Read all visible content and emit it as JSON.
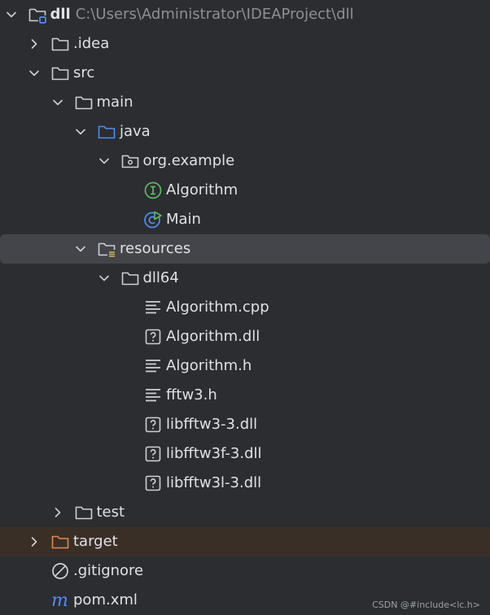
{
  "tree": [
    {
      "depth": 0,
      "label": "dll",
      "path": "C:\\Users\\Administrator\\IDEAProject\\dll",
      "icon": "module-folder-icon",
      "chevron": "down",
      "bold": true
    },
    {
      "depth": 1,
      "label": ".idea",
      "icon": "folder-icon",
      "chevron": "right"
    },
    {
      "depth": 1,
      "label": "src",
      "icon": "folder-icon",
      "chevron": "down"
    },
    {
      "depth": 2,
      "label": "main",
      "icon": "folder-icon",
      "chevron": "down"
    },
    {
      "depth": 3,
      "label": "java",
      "icon": "source-folder-icon",
      "chevron": "down"
    },
    {
      "depth": 4,
      "label": "org.example",
      "icon": "package-icon",
      "chevron": "down"
    },
    {
      "depth": 5,
      "label": "Algorithm",
      "icon": "interface-icon",
      "chevron": "none"
    },
    {
      "depth": 5,
      "label": "Main",
      "icon": "runnable-class-icon",
      "chevron": "none"
    },
    {
      "depth": 3,
      "label": "resources",
      "icon": "resources-folder-icon",
      "chevron": "down",
      "selected": true
    },
    {
      "depth": 4,
      "label": "dll64",
      "icon": "folder-icon",
      "chevron": "down"
    },
    {
      "depth": 5,
      "label": "Algorithm.cpp",
      "icon": "text-file-icon",
      "chevron": "none"
    },
    {
      "depth": 5,
      "label": "Algorithm.dll",
      "icon": "unknown-file-icon",
      "chevron": "none"
    },
    {
      "depth": 5,
      "label": "Algorithm.h",
      "icon": "text-file-icon",
      "chevron": "none"
    },
    {
      "depth": 5,
      "label": "fftw3.h",
      "icon": "text-file-icon",
      "chevron": "none"
    },
    {
      "depth": 5,
      "label": "libfftw3-3.dll",
      "icon": "unknown-file-icon",
      "chevron": "none"
    },
    {
      "depth": 5,
      "label": "libfftw3f-3.dll",
      "icon": "unknown-file-icon",
      "chevron": "none"
    },
    {
      "depth": 5,
      "label": "libfftw3l-3.dll",
      "icon": "unknown-file-icon",
      "chevron": "none"
    },
    {
      "depth": 2,
      "label": "test",
      "icon": "folder-icon",
      "chevron": "right"
    },
    {
      "depth": 1,
      "label": "target",
      "icon": "excluded-folder-icon",
      "chevron": "right",
      "excluded": true
    },
    {
      "depth": 1,
      "label": ".gitignore",
      "icon": "ignore-file-icon",
      "chevron": "none"
    },
    {
      "depth": 1,
      "label": "pom.xml",
      "icon": "maven-icon",
      "chevron": "none"
    }
  ],
  "watermark": "CSDN @#include<lc.h>",
  "colors": {
    "background": "#2b2d30",
    "selected_row": "#43454a",
    "excluded_row": "#3a2f26",
    "text": "#dfe1e5",
    "path_text": "#8c8f94",
    "source_folder": "#548af7",
    "interface_icon": "#5fb865",
    "class_icon": "#548af7",
    "run_marker": "#5fb865",
    "excluded_folder": "#e08855",
    "resources_marker": "#d6ae58",
    "maven_icon": "#548af7"
  }
}
